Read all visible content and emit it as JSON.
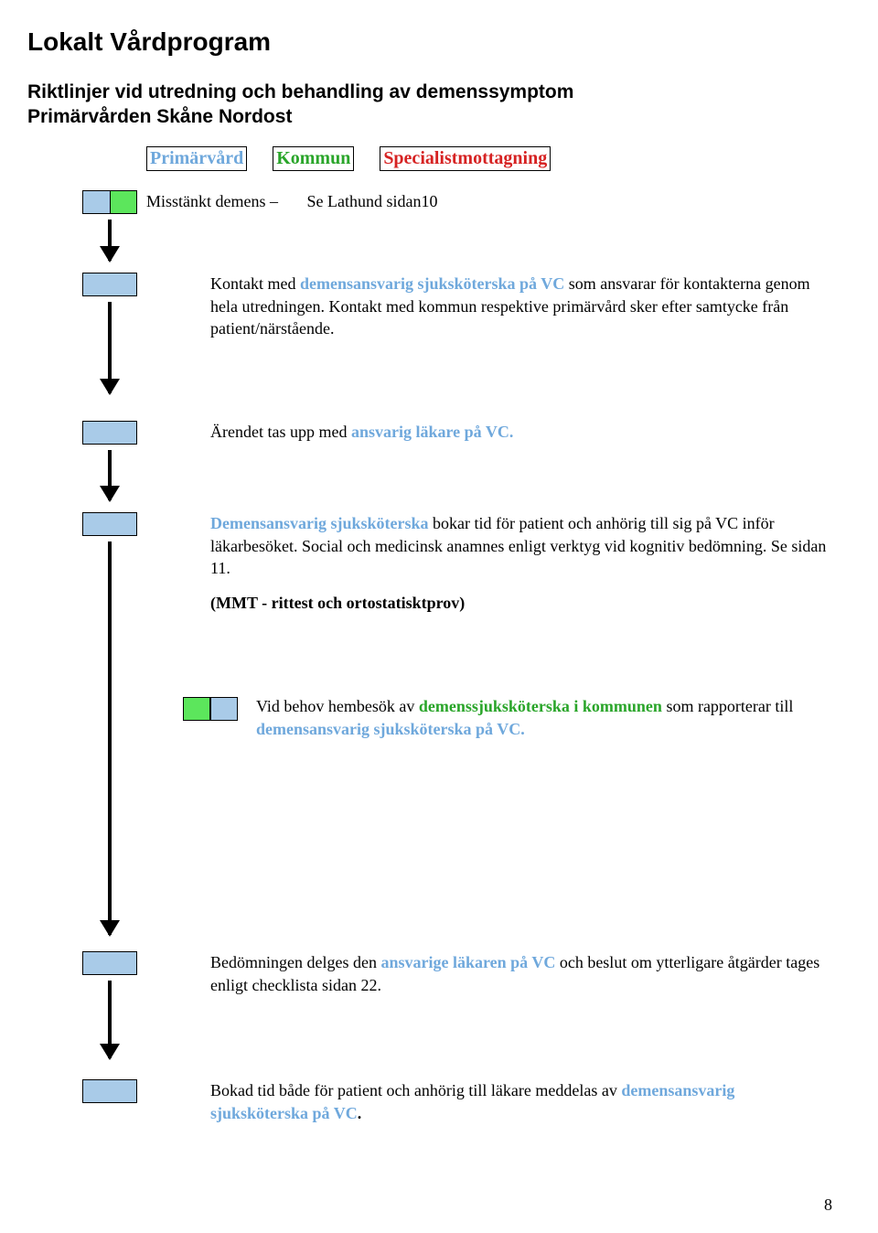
{
  "title": "Lokalt Vårdprogram",
  "subtitle_line1": "Riktlinjer vid utredning och behandling av demenssymptom",
  "subtitle_line2": "Primärvården Skåne Nordost",
  "legend": {
    "pv": "Primärvård",
    "ko": "Kommun",
    "sp": "Specialistmottagning"
  },
  "steps": {
    "s1_a": "Misstänkt demens – ",
    "s1_b": "Se Lathund sidan10",
    "s2_a": "Kontakt med ",
    "s2_b": "demensansvarig sjuksköterska på VC",
    "s2_c": " som ansvarar för kontakterna genom hela utredningen. Kontakt med kommun respektive primärvård sker efter samtycke från patient/närstående.",
    "s3_a": "Ärendet tas upp med ",
    "s3_b": "ansvarig läkare på VC.",
    "s4_a": "Demensansvarig sjuksköterska",
    "s4_b": " bokar tid för patient och anhörig till sig på VC inför läkarbesöket. Social och medicinsk anamnes enligt verktyg vid kognitiv bedömning. Se sidan 11.",
    "s4_c": "(MMT - rittest och ortostatisktprov)",
    "s5_a": "Vid behov hembesök av ",
    "s5_b": "demenssjuksköterska i kommunen",
    "s5_c": " som rapporterar till ",
    "s5_d": "demensansvarig sjuksköterska på VC.",
    "s6_a": "Bedömningen delges den ",
    "s6_b": "ansvarige läkaren på VC",
    "s6_c": " och beslut om ytterligare åtgärder tages enligt checklista sidan 22.",
    "s7_a": "Bokad tid både för patient och anhörig till läkare meddelas av ",
    "s7_b": "demensansvarig sjuksköterska på VC",
    "s7_c": "."
  },
  "page_number": "8"
}
